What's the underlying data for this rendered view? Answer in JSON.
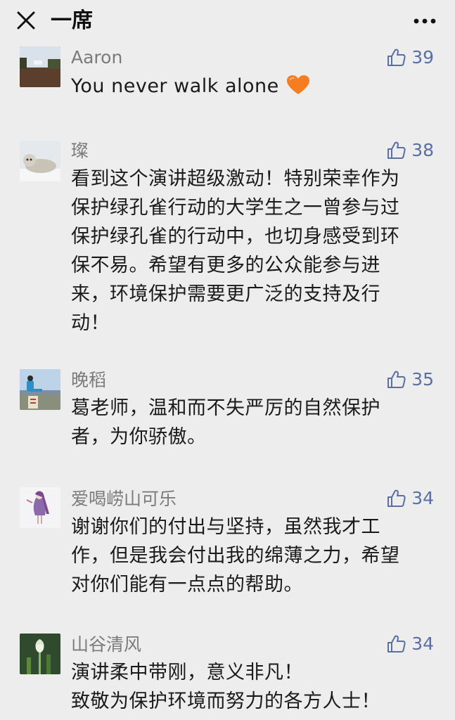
{
  "header": {
    "title": "一席"
  },
  "comments": [
    {
      "name": "Aaron",
      "likes": "39",
      "lines": [
        "You never walk alone"
      ],
      "emoji": "orange-heart"
    },
    {
      "name": "璨",
      "likes": "38",
      "lines": [
        "看到这个演讲超级激动！特别荣幸作为",
        "保护绿孔雀行动的大学生之一曾参与过",
        "保护绿孔雀的行动中，也切身感受到环",
        "保不易。希望有更多的公众能参与进",
        "来，环境保护需要更广泛的支持及行",
        "动！"
      ]
    },
    {
      "name": "晚稻",
      "likes": "35",
      "lines": [
        "葛老师，温和而不失严厉的自然保护",
        "者，为你骄傲。"
      ]
    },
    {
      "name": "爱喝崂山可乐",
      "likes": "34",
      "lines": [
        "谢谢你们的付出与坚持，虽然我才工",
        "作，但是我会付出我的绵薄之力，希望",
        "对你们能有一点点的帮助。"
      ]
    },
    {
      "name": "山谷清风",
      "likes": "34",
      "lines": [
        "演讲柔中带刚，意义非凡！",
        "致敬为保护环境而努力的各方人士！"
      ]
    }
  ],
  "colors": {
    "background": "#ededed",
    "name": "#7b7b7b",
    "like": "#5a6fa3",
    "text": "#1a1a1a"
  }
}
